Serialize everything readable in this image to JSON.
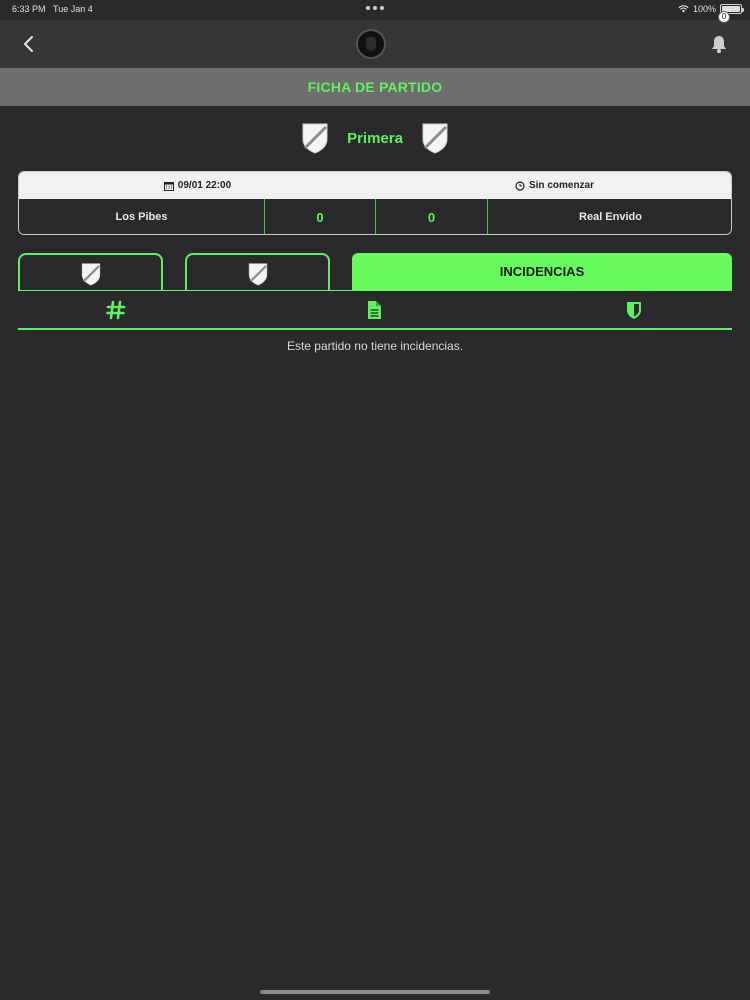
{
  "status_bar": {
    "time": "6:33 PM",
    "date": "Tue Jan 4",
    "battery": "100%"
  },
  "nav": {
    "notification_count": "0"
  },
  "page_title": "FICHA DE PARTIDO",
  "league": "Primera",
  "match": {
    "date": "09/01 22:00",
    "state": "Sin comenzar",
    "home_team": "Los Pibes",
    "home_score": "0",
    "away_score": "0",
    "away_team": "Real Envido"
  },
  "tabs": {
    "incidents_label": "INCIDENCIAS"
  },
  "incidents": {
    "empty_message": "Este partido no tiene incidencias."
  },
  "colors": {
    "accent": "#5ef25e",
    "background": "#2a2a2c",
    "title_band": "#6e6e6e"
  }
}
